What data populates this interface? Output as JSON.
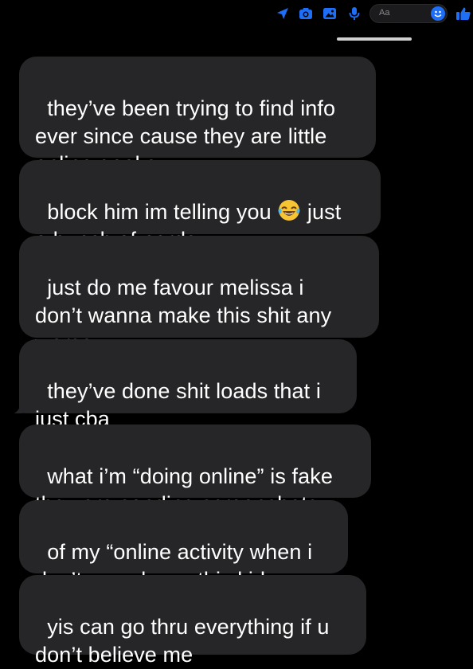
{
  "composer": {
    "placeholder": "Aa",
    "icons": [
      "location-arrow-icon",
      "camera-icon",
      "photo-icon",
      "microphone-icon",
      "emoji-icon",
      "thumbs-up-icon"
    ],
    "accent_color": "#1e6ff5"
  },
  "messages": [
    {
      "text": "they’ve been trying to find info\never since cause they are little\nonline geeks"
    },
    {
      "text_before": "block him im telling you ",
      "emoji": "face-with-tears-of-joy-icon",
      "text_after": " just\na bunch of nerds"
    },
    {
      "text": "just do me favour melissa i\ndon’t wanna make this shit any\nworse"
    },
    {
      "text": "they’ve done shit loads that i\njust cba"
    },
    {
      "text": "what i’m “doing online” is fake\nthey are sending screenshots"
    },
    {
      "text": "of my “online activity when i\ndon’t even know this kid"
    },
    {
      "text": "yis can go thru everything if u\ndon’t believe me"
    }
  ],
  "colors": {
    "background": "#000000",
    "bubble": "#262628",
    "text": "#ffffff"
  }
}
